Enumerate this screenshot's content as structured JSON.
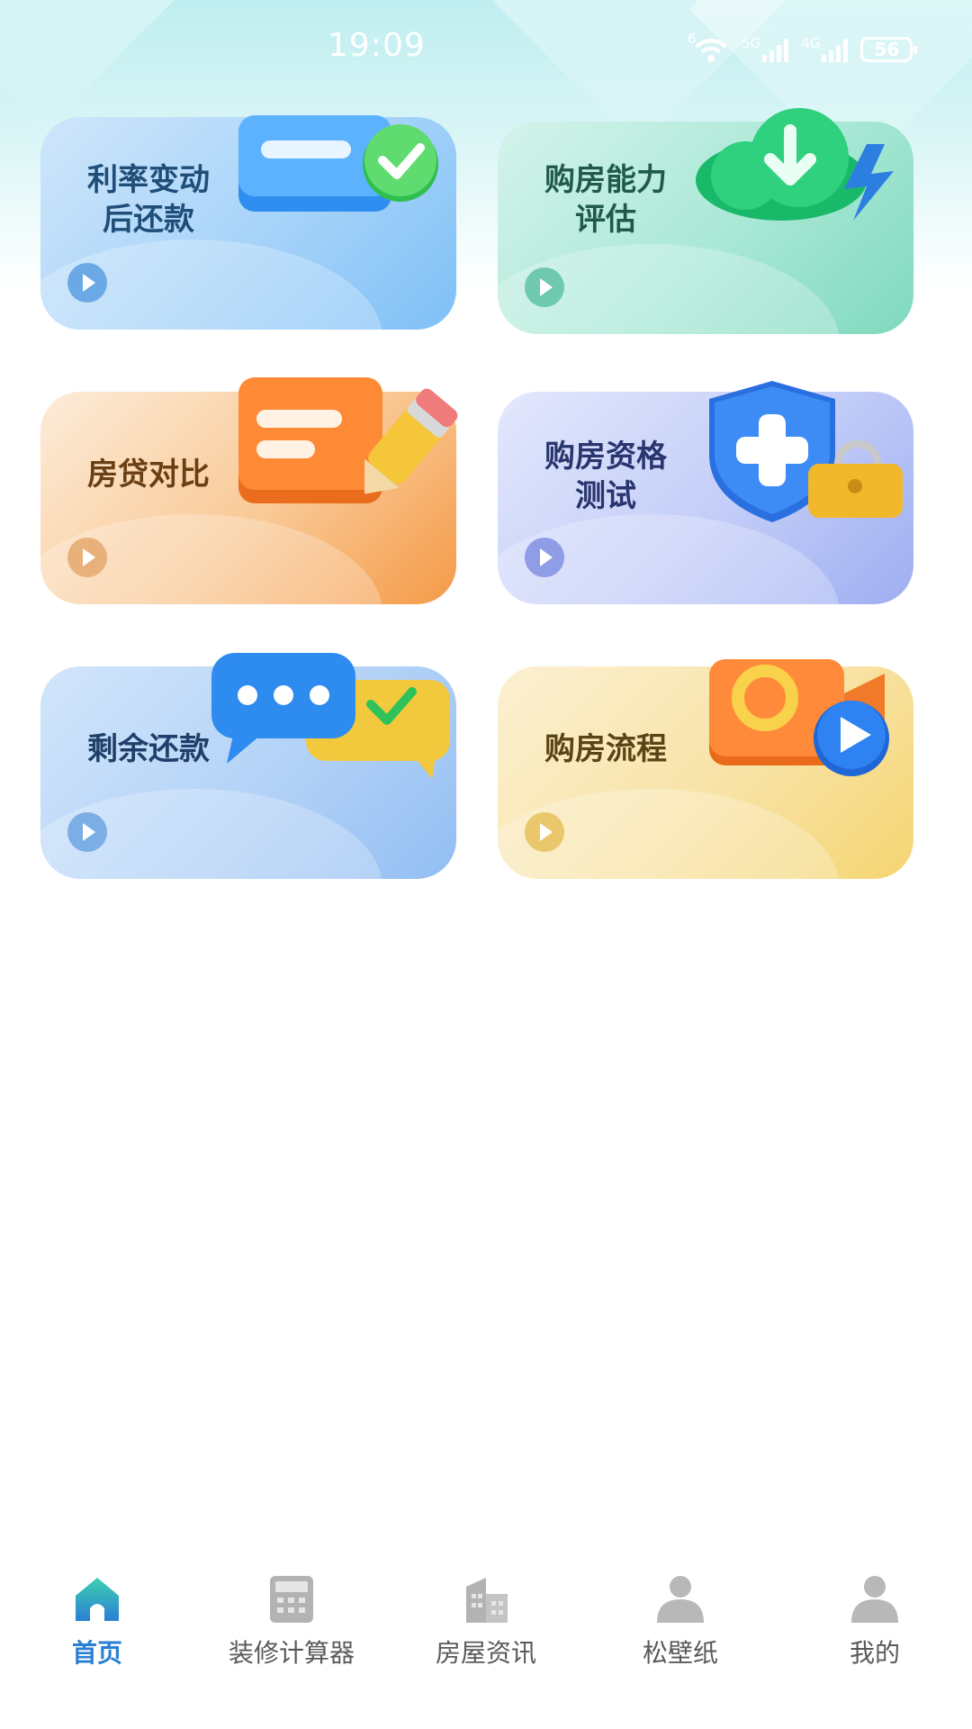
{
  "status_bar": {
    "time": "19:09",
    "battery": "56",
    "wifi_label": "6",
    "sim1_label": "5G",
    "sim2_label": "4G"
  },
  "cards": [
    {
      "title": "利率变动\n后还款",
      "icon": "card-check-icon",
      "theme": "blue"
    },
    {
      "title": "购房能力\n评估",
      "icon": "cloud-download-icon",
      "theme": "green"
    },
    {
      "title": "房贷对比",
      "icon": "note-pencil-icon",
      "theme": "orange"
    },
    {
      "title": "购房资格\n测试",
      "icon": "shield-plus-icon",
      "theme": "lavender"
    },
    {
      "title": "剩余还款",
      "icon": "chat-bubbles-icon",
      "theme": "blue"
    },
    {
      "title": "购房流程",
      "icon": "video-camera-icon",
      "theme": "yellow"
    }
  ],
  "colors": {
    "accent": "#2a7fd4",
    "blue_card": "#8ec9f7",
    "green_card": "#93e3cf",
    "orange_card": "#f8b87a",
    "lavender_card": "#b5c2f5",
    "yellow_card": "#f7e3a2"
  },
  "nav": [
    {
      "label": "首页",
      "icon": "home-icon",
      "active": true
    },
    {
      "label": "装修计算器",
      "icon": "calculator-icon",
      "active": false
    },
    {
      "label": "房屋资讯",
      "icon": "building-icon",
      "active": false
    },
    {
      "label": "松壁纸",
      "icon": "person-icon",
      "active": false
    },
    {
      "label": "我的",
      "icon": "person-icon",
      "active": false
    }
  ]
}
